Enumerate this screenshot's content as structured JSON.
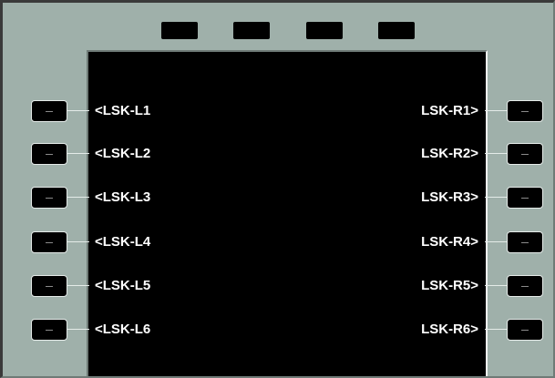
{
  "colors": {
    "bezel": "#9fb0aa",
    "screen": "#000000",
    "text": "#ffffff",
    "key": "#000000"
  },
  "top_keys": [
    {
      "icon": "blank-key"
    },
    {
      "icon": "blank-key"
    },
    {
      "icon": "blank-key"
    },
    {
      "icon": "blank-key"
    }
  ],
  "left_keys": [
    {
      "label": "<LSK-L1",
      "key_icon": "dash-icon"
    },
    {
      "label": "<LSK-L2",
      "key_icon": "dash-icon"
    },
    {
      "label": "<LSK-L3",
      "key_icon": "dash-icon"
    },
    {
      "label": "<LSK-L4",
      "key_icon": "dash-icon"
    },
    {
      "label": "<LSK-L5",
      "key_icon": "dash-icon"
    },
    {
      "label": "<LSK-L6",
      "key_icon": "dash-icon"
    }
  ],
  "right_keys": [
    {
      "label": "LSK-R1>",
      "key_icon": "dash-icon"
    },
    {
      "label": "LSK-R2>",
      "key_icon": "dash-icon"
    },
    {
      "label": "LSK-R3>",
      "key_icon": "dash-icon"
    },
    {
      "label": "LSK-R4>",
      "key_icon": "dash-icon"
    },
    {
      "label": "LSK-R5>",
      "key_icon": "dash-icon"
    },
    {
      "label": "LSK-R6>",
      "key_icon": "dash-icon"
    }
  ]
}
